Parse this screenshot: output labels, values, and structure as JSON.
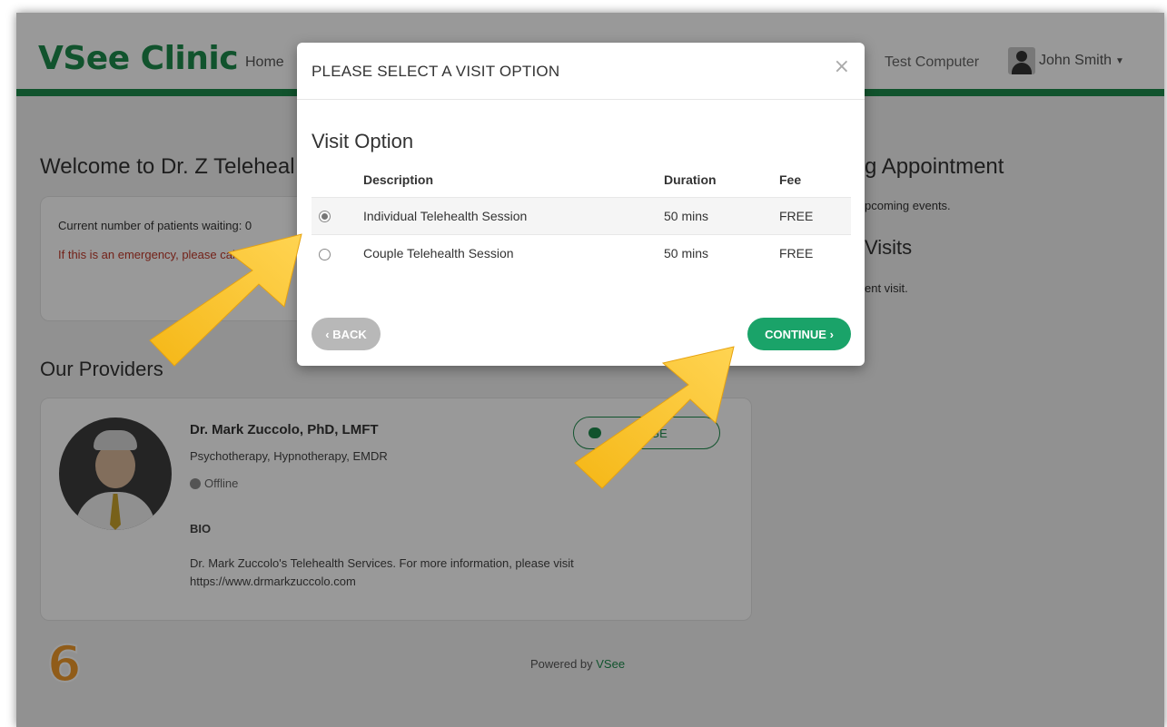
{
  "header": {
    "logo": "VSee Clinic",
    "nav_home": "Home",
    "nav_computer": "Test Computer",
    "user_name": "John Smith"
  },
  "page": {
    "welcome": "Welcome to Dr. Z Teleheal",
    "waiting": "Current number of patients waiting: 0",
    "emergency": "If this is an emergency, please call",
    "appointment_title": "g Appointment",
    "appointment_text": "pcoming events.",
    "visits_title": "Visits",
    "visits_text": "ent visit.",
    "providers_title": "Our Providers",
    "powered_prefix": "Powered by ",
    "powered_link": "VSee",
    "step_number": "6"
  },
  "provider": {
    "name": "Dr. Mark Zuccolo, PhD, LMFT",
    "specialty": "Psychotherapy, Hypnotherapy, EMDR",
    "status": "Offline",
    "bio_heading": "BIO",
    "bio": "Dr. Mark Zuccolo's Telehealth Services. For more information, please visit https://www.drmarkzuccolo.com",
    "message_label": "SSAGE"
  },
  "modal": {
    "title": "PLEASE SELECT A VISIT OPTION",
    "close": "×",
    "heading": "Visit Option",
    "columns": {
      "description": "Description",
      "duration": "Duration",
      "fee": "Fee"
    },
    "options": [
      {
        "description": "Individual Telehealth Session",
        "duration": "50 mins",
        "fee": "FREE",
        "selected": true
      },
      {
        "description": "Couple Telehealth Session",
        "duration": "50 mins",
        "fee": "FREE",
        "selected": false
      }
    ],
    "back_label": "‹ BACK",
    "continue_label": "CONTINUE ›"
  },
  "colors": {
    "brand_green": "#1d8a4c",
    "continue_green": "#1aa369",
    "arrow_yellow": "#f5b716",
    "step_orange": "#f0992a"
  }
}
